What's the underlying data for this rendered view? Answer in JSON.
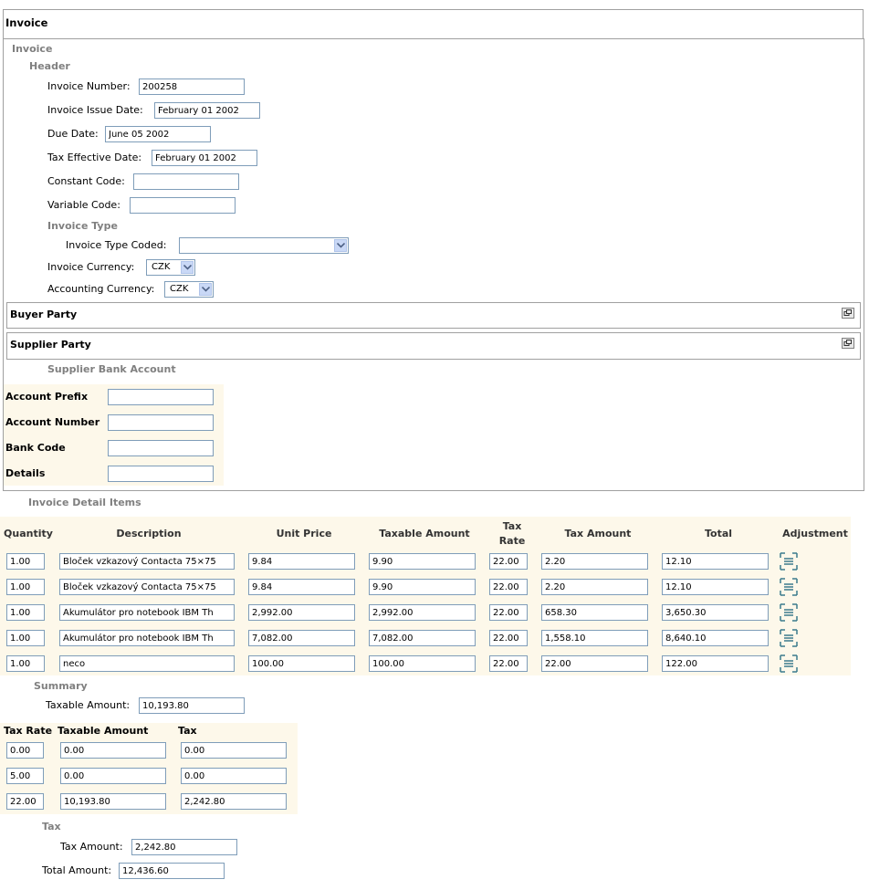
{
  "invoice_top": {
    "title": "Invoice"
  },
  "invoice": {
    "section_label": "Invoice",
    "header": {
      "label": "Header",
      "invoice_number": {
        "label": "Invoice Number:",
        "value": "200258"
      },
      "issue_date": {
        "label": "Invoice Issue Date:",
        "value": "February 01 2002"
      },
      "due_date": {
        "label": "Due Date:",
        "value": "June 05 2002"
      },
      "tax_effective_date": {
        "label": "Tax Effective Date:",
        "value": "February 01 2002"
      },
      "constant_code": {
        "label": "Constant Code:",
        "value": ""
      },
      "variable_code": {
        "label": "Variable Code:",
        "value": ""
      },
      "invoice_type": {
        "label": "Invoice Type",
        "coded": {
          "label": "Invoice Type Coded:",
          "value": ""
        }
      },
      "invoice_currency": {
        "label": "Invoice Currency:",
        "value": "CZK"
      },
      "accounting_currency": {
        "label": "Accounting Currency:",
        "value": "CZK"
      }
    },
    "buyer_party": {
      "title": "Buyer Party"
    },
    "supplier_party": {
      "title": "Supplier Party"
    },
    "supplier_bank_account": {
      "label": "Supplier Bank Account",
      "account_prefix": {
        "label": "Account Prefix",
        "value": ""
      },
      "account_number": {
        "label": "Account Number",
        "value": ""
      },
      "bank_code": {
        "label": "Bank Code",
        "value": ""
      },
      "details": {
        "label": "Details",
        "value": ""
      }
    }
  },
  "detail_items": {
    "label": "Invoice Detail Items",
    "columns": {
      "quantity": "Quantity",
      "description": "Description",
      "unit_price": "Unit Price",
      "taxable_amount": "Taxable Amount",
      "tax_rate_1": "Tax",
      "tax_rate_2": "Rate",
      "tax_amount": "Tax Amount",
      "total": "Total",
      "adjustment": "Adjustment"
    },
    "rows": [
      {
        "quantity": "1.00",
        "description": "Bloček vzkazový Contacta 75×75",
        "unit_price": "9.84",
        "taxable_amount": "9.90",
        "tax_rate": "22.00",
        "tax_amount": "2.20",
        "total": "12.10"
      },
      {
        "quantity": "1.00",
        "description": "Bloček vzkazový Contacta 75×75",
        "unit_price": "9.84",
        "taxable_amount": "9.90",
        "tax_rate": "22.00",
        "tax_amount": "2.20",
        "total": "12.10"
      },
      {
        "quantity": "1.00",
        "description": "Akumulátor pro notebook IBM Th",
        "unit_price": "2,992.00",
        "taxable_amount": "2,992.00",
        "tax_rate": "22.00",
        "tax_amount": "658.30",
        "total": "3,650.30"
      },
      {
        "quantity": "1.00",
        "description": "Akumulátor pro notebook IBM Th",
        "unit_price": "7,082.00",
        "taxable_amount": "7,082.00",
        "tax_rate": "22.00",
        "tax_amount": "1,558.10",
        "total": "8,640.10"
      },
      {
        "quantity": "1.00",
        "description": "neco",
        "unit_price": "100.00",
        "taxable_amount": "100.00",
        "tax_rate": "22.00",
        "tax_amount": "22.00",
        "total": "122.00"
      }
    ]
  },
  "summary": {
    "label": "Summary",
    "taxable_amount": {
      "label": "Taxable Amount:",
      "value": "10,193.80"
    },
    "tax_table": {
      "columns": {
        "tax_rate": "Tax Rate",
        "taxable_amount": "Taxable Amount",
        "tax": "Tax"
      },
      "rows": [
        {
          "tax_rate": "0.00",
          "taxable_amount": "0.00",
          "tax": "0.00"
        },
        {
          "tax_rate": "5.00",
          "taxable_amount": "0.00",
          "tax": "0.00"
        },
        {
          "tax_rate": "22.00",
          "taxable_amount": "10,193.80",
          "tax": "2,242.80"
        }
      ]
    },
    "tax_section": {
      "label": "Tax",
      "tax_amount": {
        "label": "Tax Amount:",
        "value": "2,242.80"
      }
    },
    "total_amount": {
      "label": "Total Amount:",
      "value": "12,436.60"
    }
  },
  "colors": {
    "border": "#a0a0a0",
    "input_border": "#7f9db9",
    "section_gray": "#808080",
    "cream_bg": "#fdf8ea"
  }
}
